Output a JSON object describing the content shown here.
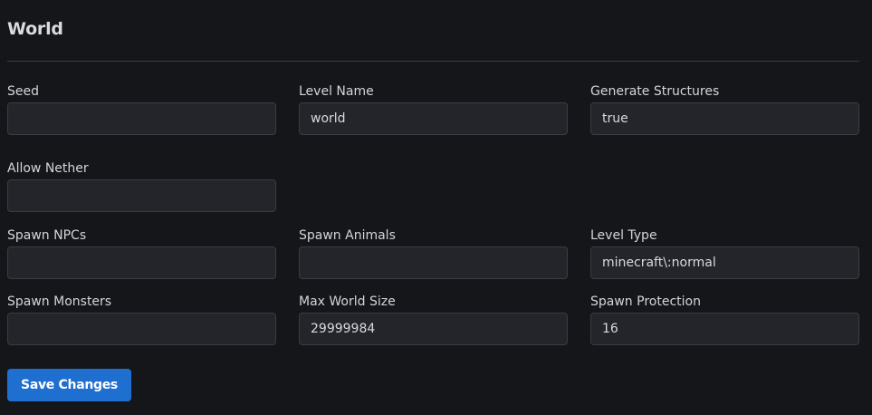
{
  "section": {
    "title": "World"
  },
  "fields": {
    "seed": {
      "label": "Seed",
      "value": ""
    },
    "level_name": {
      "label": "Level Name",
      "value": "world"
    },
    "generate_structures": {
      "label": "Generate Structures",
      "value": "true"
    },
    "allow_nether": {
      "label": "Allow Nether",
      "value": ""
    },
    "spawn_npcs": {
      "label": "Spawn NPCs",
      "value": ""
    },
    "spawn_animals": {
      "label": "Spawn Animals",
      "value": ""
    },
    "level_type": {
      "label": "Level Type",
      "value": "minecraft\\:normal"
    },
    "spawn_monsters": {
      "label": "Spawn Monsters",
      "value": ""
    },
    "max_world_size": {
      "label": "Max World Size",
      "value": "29999984"
    },
    "spawn_protection": {
      "label": "Spawn Protection",
      "value": "16"
    }
  },
  "actions": {
    "save_label": "Save Changes"
  },
  "colors": {
    "background": "#151619",
    "input_background": "#24252b",
    "input_border": "#3a3c43",
    "accent": "#1f6fd1"
  }
}
